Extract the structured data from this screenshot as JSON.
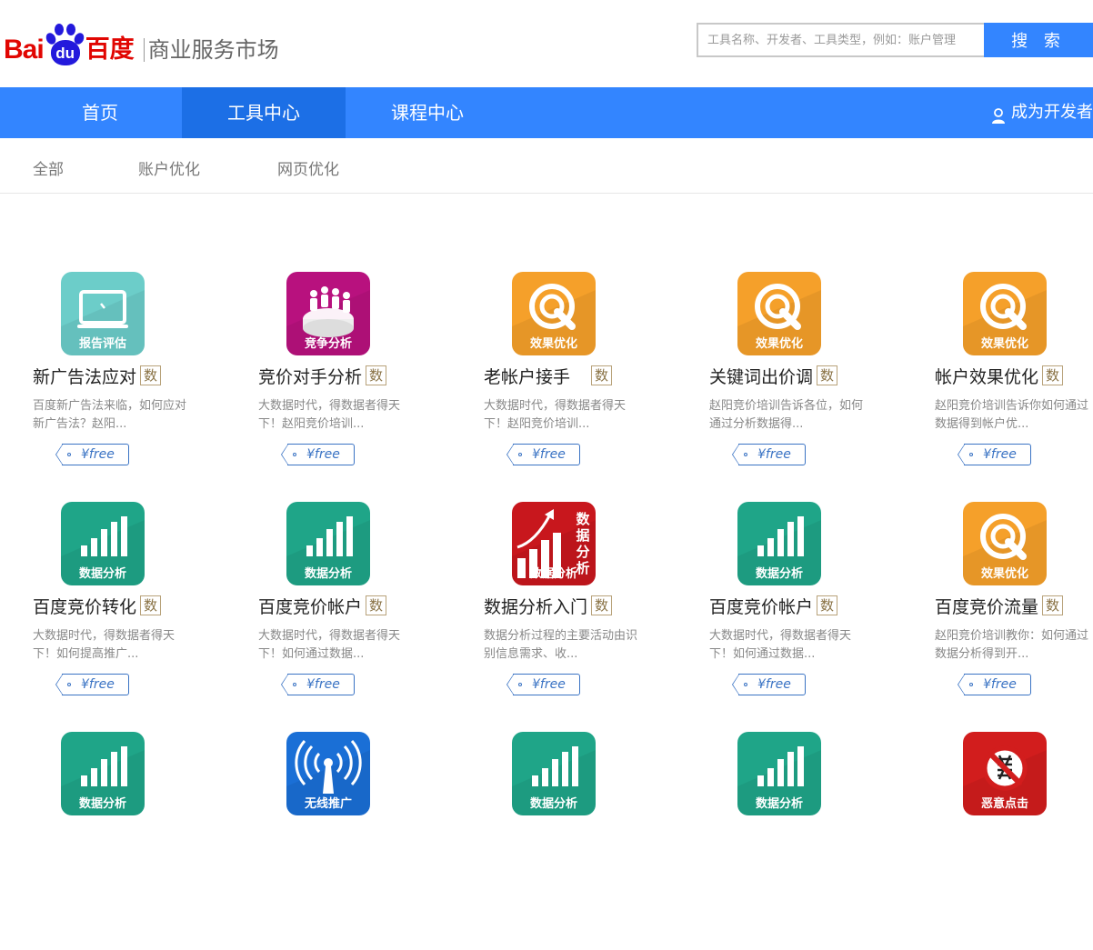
{
  "header": {
    "logo_text_latin": "Bai",
    "logo_text_paw": "du",
    "logo_text_cn": "百度",
    "logo_subtitle": "商业服务市场",
    "search_placeholder": "工具名称、开发者、工具类型，例如：账户管理",
    "search_button": "搜 索"
  },
  "nav": {
    "tabs": [
      "首页",
      "工具中心",
      "课程中心"
    ],
    "active_tab": "工具中心",
    "developer_link": "成为开发者"
  },
  "subnav": {
    "tabs": [
      "全部",
      "账户优化",
      "网页优化"
    ]
  },
  "colors": {
    "brand_blue": "#3385ff",
    "nav_active": "#1c6fe6",
    "logo_red": "#e10602",
    "logo_paw_blue": "#2319dc"
  },
  "cards": [
    {
      "title": "新广告法应对",
      "badge": "数",
      "desc": "百度新广告法来临，如何应对新广告法？赵阳...",
      "price": "¥free",
      "icon": "report-laptop-icon",
      "icon_label": "报告评估",
      "icon_color": "#6ccdc9"
    },
    {
      "title": "竞价对手分析",
      "badge": "数",
      "desc": "大数据时代，得数据者得天下！赵阳竞价培训...",
      "price": "¥free",
      "icon": "competition-people-icon",
      "icon_label": "竞争分析",
      "icon_color": "#b8117e"
    },
    {
      "title": "老帐户接手　",
      "badge": "数",
      "desc": "大数据时代，得数据者得天下！赵阳竞价培训...",
      "price": "¥free",
      "icon": "target-optimize-icon",
      "icon_label": "效果优化",
      "icon_color": "#f5a02a"
    },
    {
      "title": "关键词出价调",
      "badge": "数",
      "desc": "赵阳竞价培训告诉各位，如何通过分析数据得...",
      "price": "¥free",
      "icon": "target-optimize-icon",
      "icon_label": "效果优化",
      "icon_color": "#f5a02a"
    },
    {
      "title": "帐户效果优化",
      "badge": "数",
      "desc": "赵阳竞价培训告诉你如何通过数据得到帐户优...",
      "price": "¥free",
      "icon": "target-optimize-icon",
      "icon_label": "效果优化",
      "icon_color": "#f5a02a"
    },
    {
      "title": "百度竞价转化",
      "badge": "数",
      "desc": "大数据时代，得数据者得天下！如何提高推广...",
      "price": "¥free",
      "icon": "bar-chart-icon",
      "icon_label": "数据分析",
      "icon_color": "#1fa588"
    },
    {
      "title": "百度竞价帐户",
      "badge": "数",
      "desc": "大数据时代，得数据者得天下！如何通过数据...",
      "price": "¥free",
      "icon": "bar-chart-icon",
      "icon_label": "数据分析",
      "icon_color": "#1fa588"
    },
    {
      "title": "数据分析入门",
      "badge": "数",
      "desc": "数据分析过程的主要活动由识别信息需求、收...",
      "price": "¥free",
      "icon": "growth-chart-icon",
      "icon_label": "数据分析",
      "icon_color": "#c8171d"
    },
    {
      "title": "百度竞价帐户",
      "badge": "数",
      "desc": "大数据时代，得数据者得天下！如何通过数据...",
      "price": "¥free",
      "icon": "bar-chart-icon",
      "icon_label": "数据分析",
      "icon_color": "#1fa588"
    },
    {
      "title": "百度竞价流量",
      "badge": "数",
      "desc": "赵阳竞价培训教你：如何通过数据分析得到开...",
      "price": "¥free",
      "icon": "target-optimize-icon",
      "icon_label": "效果优化",
      "icon_color": "#f5a02a"
    },
    {
      "title": "",
      "badge": "",
      "desc": "",
      "price": "",
      "icon": "bar-chart-icon",
      "icon_label": "数据分析",
      "icon_color": "#1fa588"
    },
    {
      "title": "",
      "badge": "",
      "desc": "",
      "price": "",
      "icon": "wireless-icon",
      "icon_label": "无线推广",
      "icon_color": "#1a6fd6"
    },
    {
      "title": "",
      "badge": "",
      "desc": "",
      "price": "",
      "icon": "bar-chart-icon",
      "icon_label": "数据分析",
      "icon_color": "#1fa588"
    },
    {
      "title": "",
      "badge": "",
      "desc": "",
      "price": "",
      "icon": "bar-chart-icon",
      "icon_label": "数据分析",
      "icon_color": "#1fa588"
    },
    {
      "title": "",
      "badge": "",
      "desc": "",
      "price": "",
      "icon": "no-click-icon",
      "icon_label": "恶意点击",
      "icon_color": "#d21d1d"
    }
  ]
}
